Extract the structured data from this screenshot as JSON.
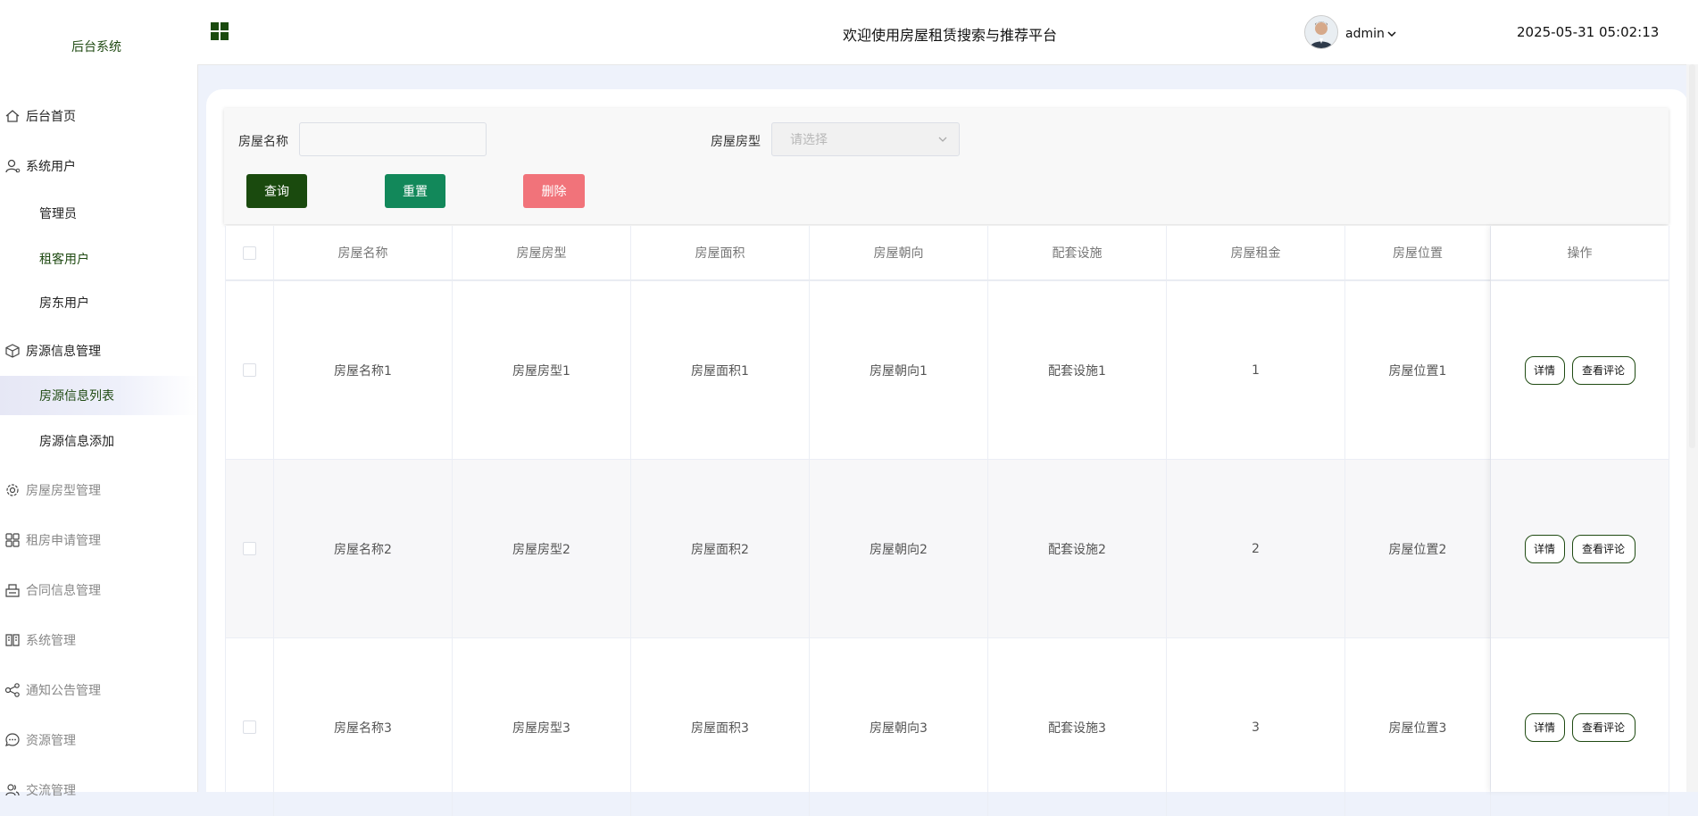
{
  "sidebar": {
    "brand": "后台系统",
    "items": {
      "home": "后台首页",
      "system_users": "系统用户",
      "admin": "管理员",
      "tenant_users": "租客用户",
      "landlord_users": "房东用户",
      "listing_mgmt": "房源信息管理",
      "listing_list": "房源信息列表",
      "listing_add": "房源信息添加",
      "house_type_mgmt": "房屋房型管理",
      "rental_apply_mgmt": "租房申请管理",
      "contract_mgmt": "合同信息管理",
      "system_mgmt": "系统管理",
      "notice_mgmt": "通知公告管理",
      "resource_mgmt": "资源管理",
      "exchange_mgmt": "交流管理"
    }
  },
  "header": {
    "title": "欢迎使用房屋租赁搜索与推荐平台",
    "username": "admin",
    "datetime": "2025-05-31 05:02:13"
  },
  "search": {
    "name_label": "房屋名称",
    "name_value": "",
    "type_label": "房屋房型",
    "type_placeholder": "请选择",
    "query_button": "查询",
    "reset_button": "重置",
    "delete_button": "删除"
  },
  "colors": {
    "primary_dark_green": "#1a4a0e",
    "reset_green": "#12885a",
    "delete_red": "#f1737a"
  },
  "table": {
    "headers": [
      "房屋名称",
      "房屋房型",
      "房屋面积",
      "房屋朝向",
      "配套设施",
      "房屋租金",
      "房屋位置",
      "操作"
    ],
    "rows": [
      {
        "name": "房屋名称1",
        "type": "房屋房型1",
        "area": "房屋面积1",
        "orientation": "房屋朝向1",
        "facilities": "配套设施1",
        "rent": "1",
        "location": "房屋位置1"
      },
      {
        "name": "房屋名称2",
        "type": "房屋房型2",
        "area": "房屋面积2",
        "orientation": "房屋朝向2",
        "facilities": "配套设施2",
        "rent": "2",
        "location": "房屋位置2"
      },
      {
        "name": "房屋名称3",
        "type": "房屋房型3",
        "area": "房屋面积3",
        "orientation": "房屋朝向3",
        "facilities": "配套设施3",
        "rent": "3",
        "location": "房屋位置3"
      }
    ],
    "detail_button": "详情",
    "comments_button": "查看评论"
  }
}
